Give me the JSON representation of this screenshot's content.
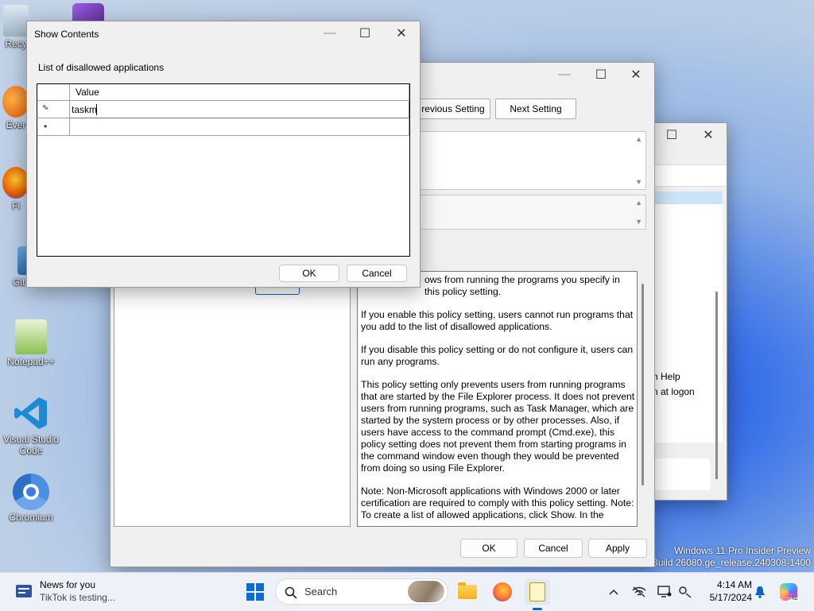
{
  "desktop": {
    "icons": [
      {
        "label": "Recy"
      },
      {
        "label": "Ever"
      },
      {
        "label": "Fi"
      },
      {
        "label": "Git Bash"
      },
      {
        "label": "Notepad++"
      },
      {
        "label": "Visual Studio Code"
      },
      {
        "label": "Chromium"
      }
    ],
    "watermark_line1": "Windows 11 Pro Insider Preview",
    "watermark_line2": "y. Build 26080.ge_release.240308-1400"
  },
  "show_contents": {
    "title": "Show Contents",
    "list_label": "List of disallowed applications",
    "column_header": "Value",
    "rows": [
      {
        "marker": "✎",
        "value": "taskm"
      },
      {
        "marker": "•",
        "value": ""
      }
    ],
    "ok_label": "OK",
    "cancel_label": "Cancel"
  },
  "policy_dialog": {
    "previous_label": "revious Setting",
    "next_label": "Next Setting",
    "help_paragraphs": [
      "ows from running the programs you specify in this policy setting.",
      "If you enable this policy setting, users cannot run programs that you add to the list of disallowed applications.",
      "If you disable this policy setting or do not configure it, users can run any programs.",
      "This policy setting only prevents users from running programs that are started by the File Explorer process. It does not prevent users from running programs, such as Task Manager, which are started by the system process or by other processes.  Also, if users have access to the command prompt (Cmd.exe), this policy setting does not prevent them from starting programs in the command window even though they would be prevented from doing so using File Explorer.",
      "Note: Non-Microsoft applications with Windows 2000 or later certification are required to comply with this policy setting. Note: To create a list of allowed applications, click Show.  In the"
    ],
    "ok_label": "OK",
    "cancel_label": "Cancel",
    "apply_label": "Apply"
  },
  "back_window": {
    "line1": "n Help",
    "line2": "n at logon"
  },
  "taskbar": {
    "news_title": "News for you",
    "news_subtitle": "TikTok is testing...",
    "search_placeholder": "Search",
    "time": "4:14 AM",
    "date": "5/17/2024"
  },
  "colors": {
    "accent": "#0067c0",
    "selection": "#cce4f7"
  }
}
